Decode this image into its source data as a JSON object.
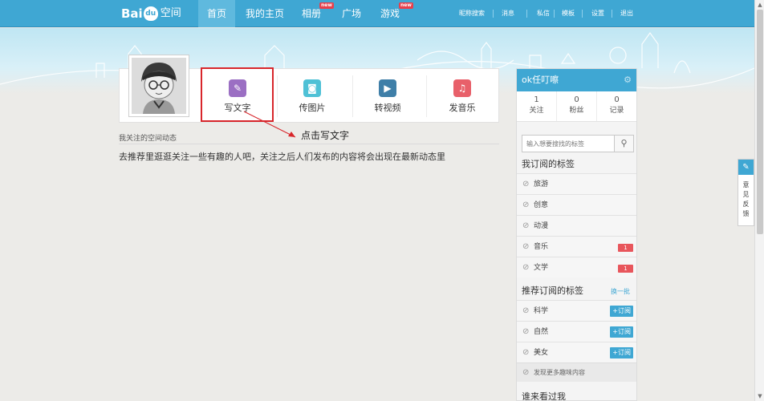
{
  "nav": {
    "logo_bai": "Bai",
    "logo_paw": "du",
    "logo_space": "空间",
    "items": [
      {
        "label": "首页"
      },
      {
        "label": "我的主页"
      },
      {
        "label": "相册",
        "badge": "new"
      },
      {
        "label": "广场"
      },
      {
        "label": "游戏",
        "badge": "new"
      }
    ],
    "utilities": [
      "昵称搜索",
      "消息",
      "私信",
      "模板",
      "设置",
      "退出"
    ]
  },
  "publish": {
    "buttons": [
      {
        "label": "写文字",
        "icon": "pencil-icon",
        "color": "#9b6fc3",
        "glyph": "✎"
      },
      {
        "label": "传图片",
        "icon": "camera-icon",
        "color": "#4fc1d6",
        "glyph": "◙"
      },
      {
        "label": "转视频",
        "icon": "play-icon",
        "color": "#3f7fa8",
        "glyph": "▶"
      },
      {
        "label": "发音乐",
        "icon": "music-note-icon",
        "color": "#e8606a",
        "glyph": "♫"
      }
    ],
    "annotation": "点击写文字"
  },
  "feed": {
    "title": "我关注的空间动态",
    "empty_message": "去推荐里逛逛关注一些有趣的人吧，关注之后人们发布的内容将会出现在最新动态里"
  },
  "sidebar": {
    "username": "ok任叮嚓",
    "stats": [
      {
        "num": "1",
        "label": "关注"
      },
      {
        "num": "0",
        "label": "粉丝"
      },
      {
        "num": "0",
        "label": "记录"
      }
    ],
    "search_placeholder": "输入想要搜找的标签",
    "subscribed_title": "我订阅的标签",
    "subscribed_tags": [
      {
        "label": "旅游"
      },
      {
        "label": "创意"
      },
      {
        "label": "动漫"
      },
      {
        "label": "音乐",
        "count": "1"
      },
      {
        "label": "文学",
        "count": "1"
      }
    ],
    "recommended_title": "推荐订阅的标签",
    "refresh_label": "换一批",
    "subscribe_label": "+订阅",
    "recommended_tags": [
      {
        "label": "科学"
      },
      {
        "label": "自然"
      },
      {
        "label": "美女"
      }
    ],
    "discover_more": "发现更多趣味内容",
    "visitors_title": "谁来看过我"
  },
  "feedback": {
    "label": "意见反馈"
  },
  "colors": {
    "accent": "#3fa7d3",
    "highlight": "#d8262b",
    "badge": "#e8565c"
  }
}
